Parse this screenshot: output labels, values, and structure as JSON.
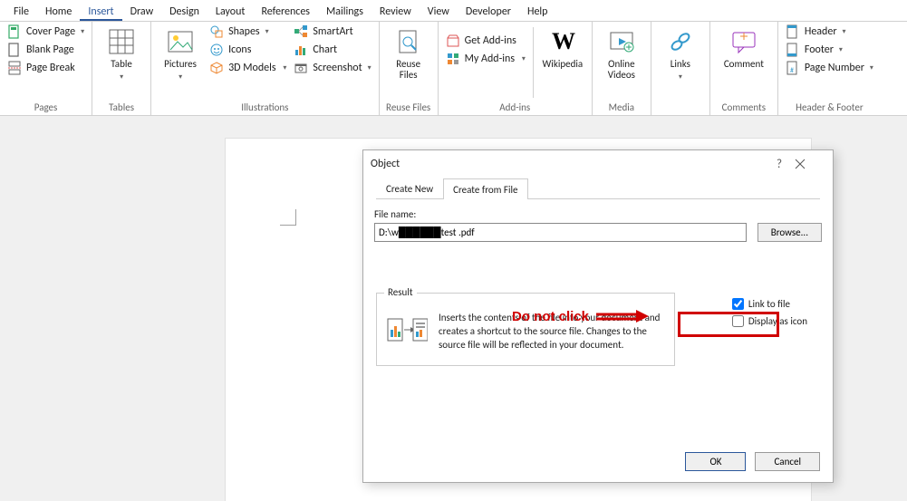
{
  "tabs": [
    "File",
    "Home",
    "Insert",
    "Draw",
    "Design",
    "Layout",
    "References",
    "Mailings",
    "Review",
    "View",
    "Developer",
    "Help"
  ],
  "active_tab_index": 2,
  "ribbon": {
    "pages": {
      "label": "Pages",
      "cover_page": "Cover Page",
      "blank_page": "Blank Page",
      "page_break": "Page Break"
    },
    "tables": {
      "label": "Tables",
      "table": "Table"
    },
    "illustrations": {
      "label": "Illustrations",
      "pictures": "Pictures",
      "shapes": "Shapes",
      "icons": "Icons",
      "models": "3D Models",
      "smartart": "SmartArt",
      "chart": "Chart",
      "screenshot": "Screenshot"
    },
    "reuse": {
      "label": "Reuse Files",
      "reuse": "Reuse Files"
    },
    "addins": {
      "label": "Add-ins",
      "get": "Get Add-ins",
      "my": "My Add-ins",
      "wikipedia": "Wikipedia"
    },
    "media": {
      "label": "Media",
      "online_videos": "Online Videos"
    },
    "links": {
      "label": "",
      "links": "Links"
    },
    "comments": {
      "label": "Comments",
      "comment": "Comment"
    },
    "header_footer": {
      "label": "Header & Footer",
      "header": "Header",
      "footer": "Footer",
      "page_number": "Page Number"
    }
  },
  "dialog": {
    "title": "Object",
    "help": "?",
    "close": "×",
    "tab_create_new": "Create New",
    "tab_create_from_file": "Create from File",
    "file_name_label": "File name:",
    "file_name_value": "D:\\w██████test .pdf",
    "browse": "Browse...",
    "link_to_file": "Link to file",
    "display_as_icon": "Display as icon",
    "result_legend": "Result",
    "result_desc": "Inserts the contents of the file into your document and creates a shortcut to the source file.  Changes to the source file will be reflected in your document.",
    "ok": "OK",
    "cancel": "Cancel",
    "link_checked": true,
    "display_checked": false
  },
  "annotation": {
    "text": "Do not click"
  }
}
